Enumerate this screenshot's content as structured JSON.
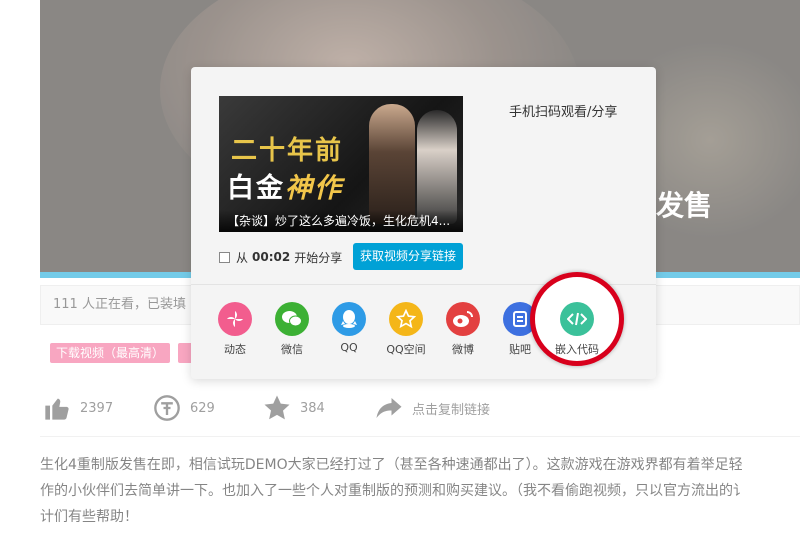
{
  "video": {
    "overlay_caption": "发售"
  },
  "stats": {
    "text": "111 人正在看，已装填 5"
  },
  "tags": [
    {
      "label": "下载视频（最高清）"
    },
    {
      "label": ""
    }
  ],
  "actions": {
    "like": {
      "icon": "thumbs-up-icon",
      "count": "2397"
    },
    "coin": {
      "icon": "coin-icon",
      "count": "629"
    },
    "favorite": {
      "icon": "star-icon",
      "count": "384"
    },
    "share": {
      "icon": "share-arrow-icon",
      "label": "点击复制链接"
    }
  },
  "description": {
    "line1": "生化4重制版发售在即，相信试玩DEMO大家已经打过了（甚至各种速通都出了）。这款游戏在游戏界都有着举足轻",
    "line2": "作的小伙伴们去简单讲一下。也加入了一些个人对重制版的预测和购买建议。（我不看偷跑视频，只以官方流出的讠",
    "line3": "计们有些帮助！"
  },
  "share_panel": {
    "thumbnail": {
      "line1": "二十年前",
      "line2_a": "白金",
      "line2_b": "神作",
      "caption": "【杂谈】炒了这么多遍冷饭，生化危机4..."
    },
    "qr_label": "手机扫码观看/分享",
    "start_from": {
      "prefix": "从",
      "time": "00:02",
      "suffix": "开始分享",
      "checked": false
    },
    "get_link_button": "获取视频分享链接",
    "platforms": [
      {
        "label": "动态",
        "icon": "pinwheel-icon",
        "color": "#f25d8e"
      },
      {
        "label": "微信",
        "icon": "wechat-icon",
        "color": "#3cb034"
      },
      {
        "label": "QQ",
        "icon": "qq-icon",
        "color": "#2e9be6"
      },
      {
        "label": "QQ空间",
        "icon": "qzone-star-icon",
        "color": "#f4b619"
      },
      {
        "label": "微博",
        "icon": "weibo-icon",
        "color": "#e34040"
      },
      {
        "label": "贴吧",
        "icon": "tieba-icon",
        "color": "#3d70e0"
      },
      {
        "label": "嵌入代码",
        "icon": "embed-code-icon",
        "color": "#3bc19a"
      }
    ]
  }
}
